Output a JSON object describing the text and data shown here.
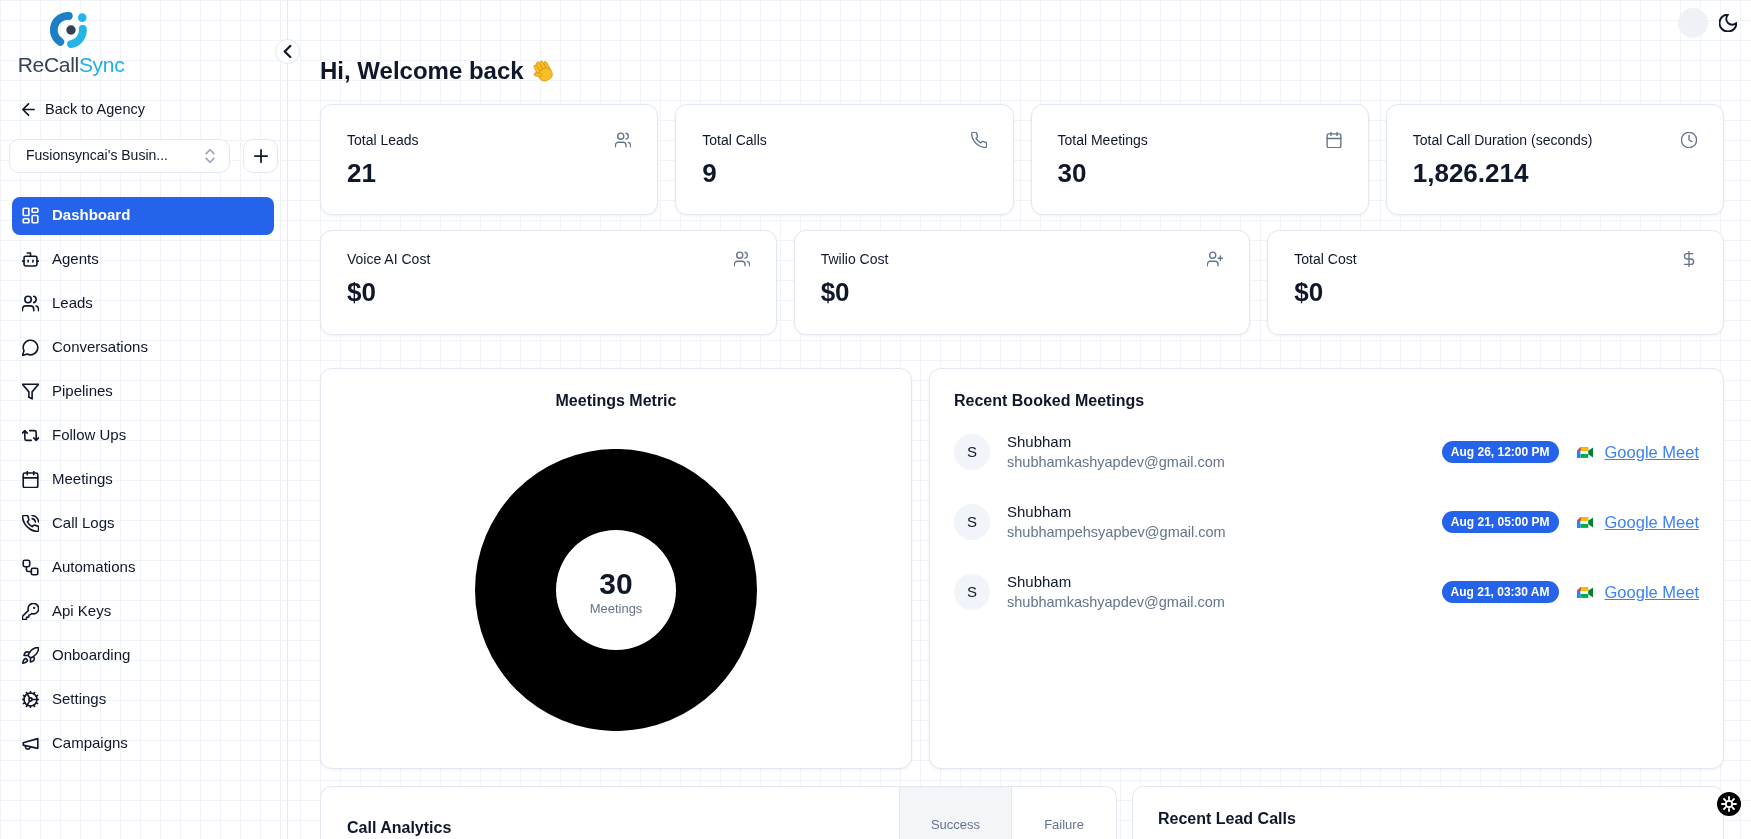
{
  "sidebar": {
    "logo": {
      "text_dark": "ReCall",
      "text_accent": "Sync"
    },
    "back_link": "Back to Agency",
    "workspace_select": {
      "value": "Fusionsyncai's Busin..."
    },
    "nav_items": [
      {
        "label": "Dashboard",
        "selected": true
      },
      {
        "label": "Agents",
        "selected": false
      },
      {
        "label": "Leads",
        "selected": false
      },
      {
        "label": "Conversations",
        "selected": false
      },
      {
        "label": "Pipelines",
        "selected": false
      },
      {
        "label": "Follow Ups",
        "selected": false
      },
      {
        "label": "Meetings",
        "selected": false
      },
      {
        "label": "Call Logs",
        "selected": false
      },
      {
        "label": "Automations",
        "selected": false
      },
      {
        "label": "Api Keys",
        "selected": false
      },
      {
        "label": "Onboarding",
        "selected": false
      },
      {
        "label": "Settings",
        "selected": false
      },
      {
        "label": "Campaigns",
        "selected": false
      }
    ]
  },
  "header": {
    "greeting": "Hi, Welcome back"
  },
  "stats_row_1": [
    {
      "label": "Total Leads",
      "value": "21"
    },
    {
      "label": "Total Calls",
      "value": "9"
    },
    {
      "label": "Total Meetings",
      "value": "30"
    },
    {
      "label": "Total Call Duration (seconds)",
      "value": "1,826.214"
    }
  ],
  "stats_row_2": [
    {
      "label": "Voice AI Cost",
      "value": "$0"
    },
    {
      "label": "Twilio Cost",
      "value": "$0"
    },
    {
      "label": "Total Cost",
      "value": "$0"
    }
  ],
  "meetings_metric": {
    "title": "Meetings Metric",
    "total": "30",
    "total_label": "Meetings"
  },
  "recent_booked_meetings": {
    "title": "Recent Booked Meetings",
    "items": [
      {
        "initial": "S",
        "name": "Shubham",
        "email": "shubhamkashyapdev@gmail.com",
        "time": "Aug 26, 12:00 PM",
        "link": "Google Meet"
      },
      {
        "initial": "S",
        "name": "Shubham",
        "email": "shubhampehsyapbev@gmail.com",
        "time": "Aug 21, 05:00 PM",
        "link": "Google Meet"
      },
      {
        "initial": "S",
        "name": "Shubham",
        "email": "shubhamkashyapdev@gmail.com",
        "time": "Aug 21, 03:30 AM",
        "link": "Google Meet"
      }
    ]
  },
  "call_analytics": {
    "title": "Call Analytics",
    "toggles": [
      {
        "label": "Success",
        "selected": true
      },
      {
        "label": "Failure",
        "selected": false
      }
    ]
  },
  "recent_lead_calls": {
    "title": "Recent Lead Calls"
  }
}
